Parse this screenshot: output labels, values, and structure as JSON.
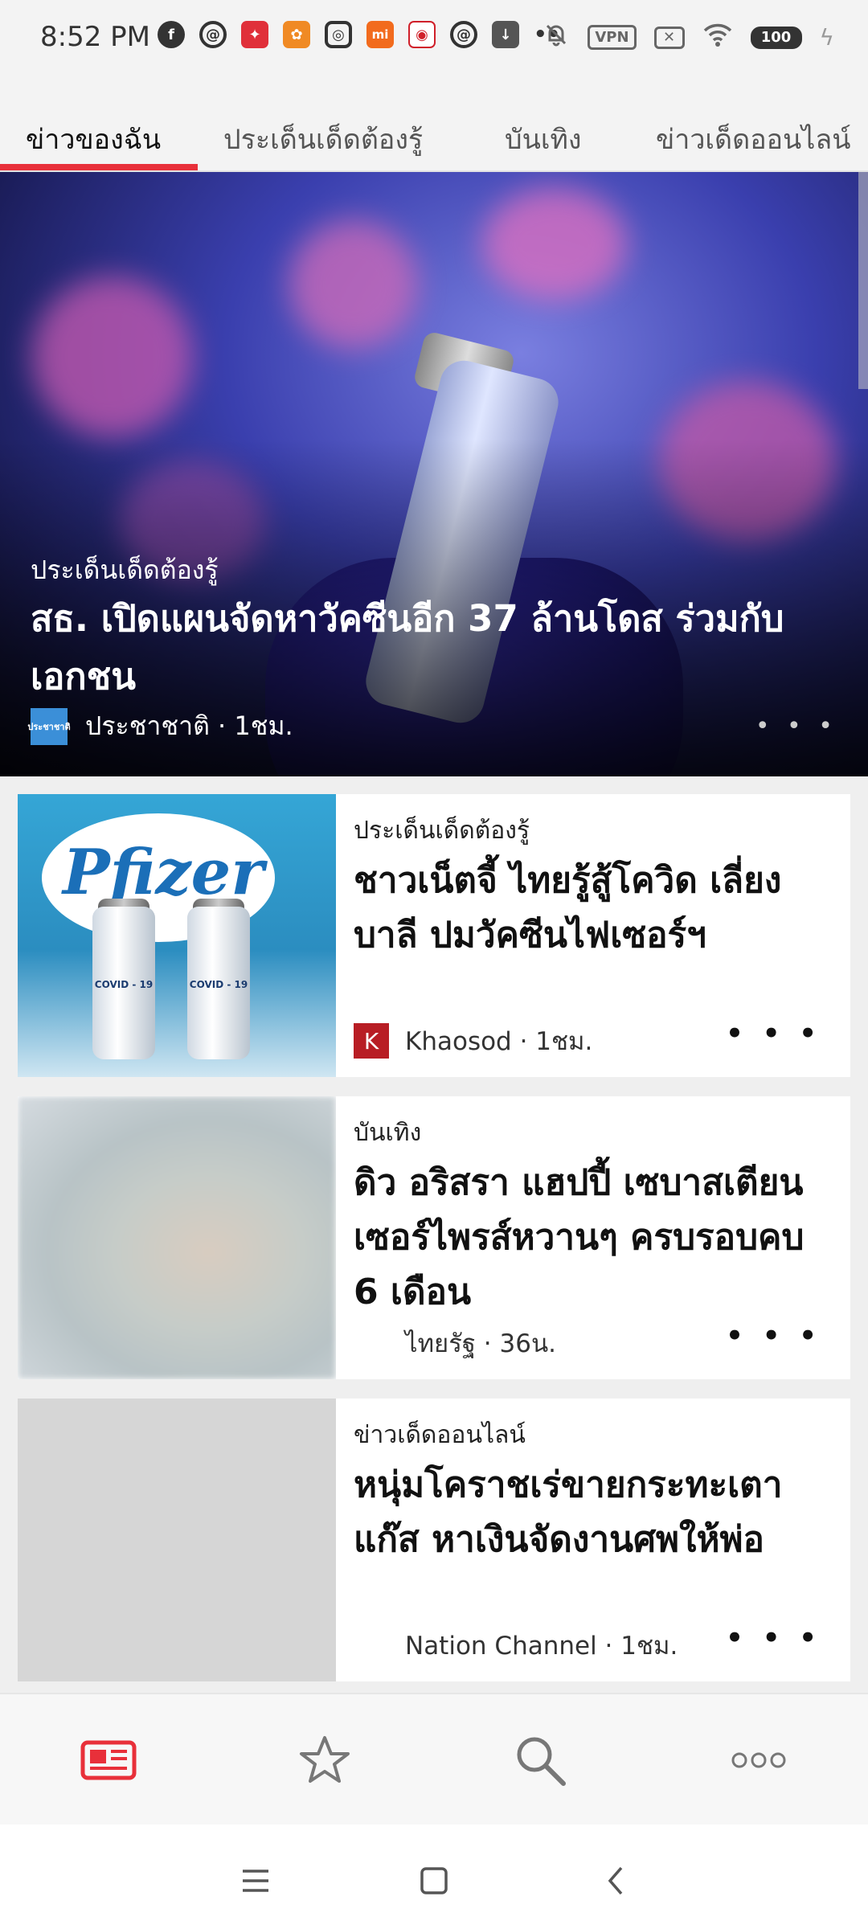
{
  "status_bar": {
    "time": "8:52 PM",
    "notification_icons": [
      "facebook-icon",
      "at-sign-icon",
      "app-icon-red",
      "app-icon-orange",
      "instagram-icon",
      "mi-icon",
      "app-icon-red-2",
      "at-sign-icon",
      "download-icon",
      "more-dots-icon"
    ],
    "mi_label": "mi",
    "vpn_label": "VPN",
    "battery": "100"
  },
  "tabs": [
    {
      "label": "ข่าวของฉัน",
      "active": true
    },
    {
      "label": "ประเด็นเด็ดต้องรู้",
      "active": false
    },
    {
      "label": "บันเทิง",
      "active": false
    },
    {
      "label": "ข่าวเด็ดออนไลน์",
      "active": false
    }
  ],
  "hero": {
    "category": "ประเด็นเด็ดต้องรู้",
    "title": "สธ. เปิดแผนจัดหาวัคซีนอีก 37 ล้านโดส ร่วมกับเอกชน",
    "source": "ประชาชาติ · 1ชม.",
    "more": "• • •"
  },
  "articles": [
    {
      "category": "ประเด็นเด็ดต้องรู้",
      "title": "ชาวเน็ตจี้ ไทยรู้สู้โควิด เลี่ยงบาลี ปมวัคซีนไฟเซอร์ฯ",
      "source": "Khaosod · 1ชม.",
      "logo_letter": "K",
      "more": "• • •",
      "image": {
        "brand": "Pfizer",
        "vial_label": "COVID - 19"
      }
    },
    {
      "category": "บันเทิง",
      "title": "ดิว อริสรา แฮปปี้ เซบาสเตียน เซอร์ไพรส์หวานๆ ครบรอบคบ 6 เดือน",
      "source": "ไทยรัฐ · 36น.",
      "more": "• • •"
    },
    {
      "category": "ข่าวเด็ดออนไลน์",
      "title": "หนุ่มโคราชเร่ขายกระทะเตาแก๊ส หาเงินจัดงานศพให้พ่อ",
      "source": "Nation Channel · 1ชม.",
      "more": "• • •"
    }
  ],
  "bottom_nav": {
    "items": [
      "news-icon",
      "star-icon",
      "search-icon",
      "more-icon"
    ],
    "accent_color": "#e8303a"
  }
}
